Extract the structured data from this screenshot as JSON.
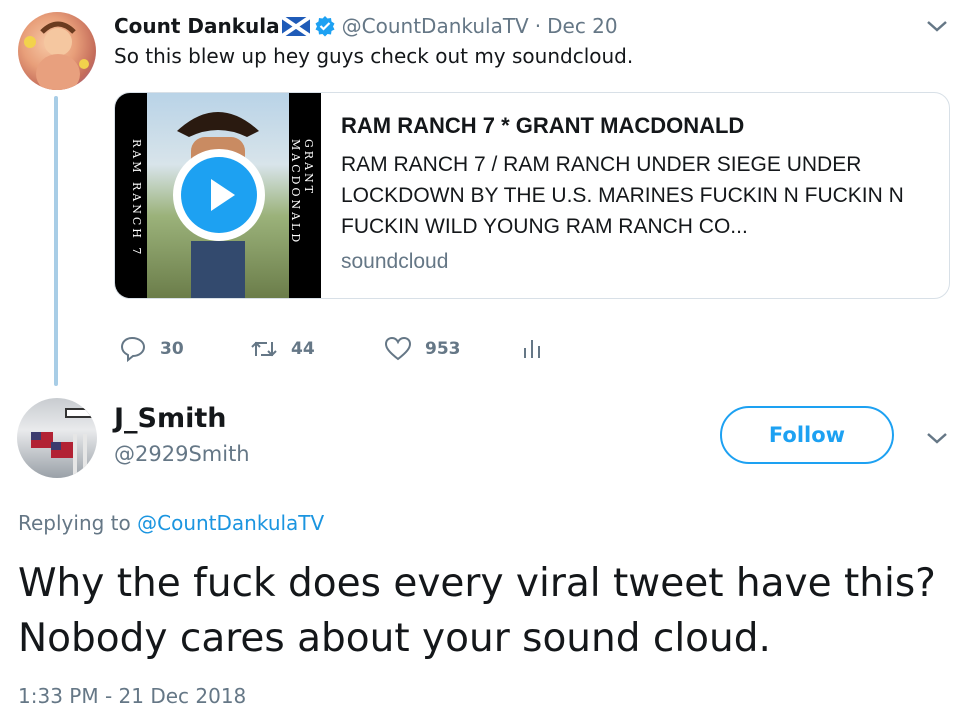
{
  "parent_tweet": {
    "display_name": "Count Dankula",
    "handle": "@CountDankulaTV",
    "separator": "·",
    "date": "Dec 20",
    "text": "So this blew up hey guys check out my soundcloud.",
    "card": {
      "title": "RAM RANCH 7 * GRANT MACDONALD",
      "description": "RAM RANCH 7 / RAM RANCH UNDER SIEGE UNDER LOCKDOWN BY THE U.S. MARINES FUCKIN N FUCKIN N FUCKIN WILD YOUNG RAM RANCH CO...",
      "domain": "soundcloud",
      "thumb_left_text": "RAM RANCH 7",
      "thumb_right_text": "GRANT MACDONALD"
    },
    "actions": {
      "replies": "30",
      "retweets": "44",
      "likes": "953"
    }
  },
  "reply_tweet": {
    "display_name": "J_Smith",
    "handle": "@2929Smith",
    "follow_label": "Follow",
    "replying_prefix": "Replying to",
    "replying_to": "@CountDankulaTV",
    "text": "Why the fuck does every viral tweet have this? Nobody cares about your sound cloud.",
    "timestamp": "1:33 PM - 21 Dec 2018"
  },
  "colors": {
    "accent": "#1da1f2",
    "muted": "#657786",
    "text": "#14171a",
    "thread_line": "#a8cde6"
  },
  "icons": [
    "verified-icon",
    "scotland-flag-icon",
    "chevron-down-icon",
    "reply-icon",
    "retweet-icon",
    "like-icon",
    "analytics-icon",
    "play-icon"
  ]
}
